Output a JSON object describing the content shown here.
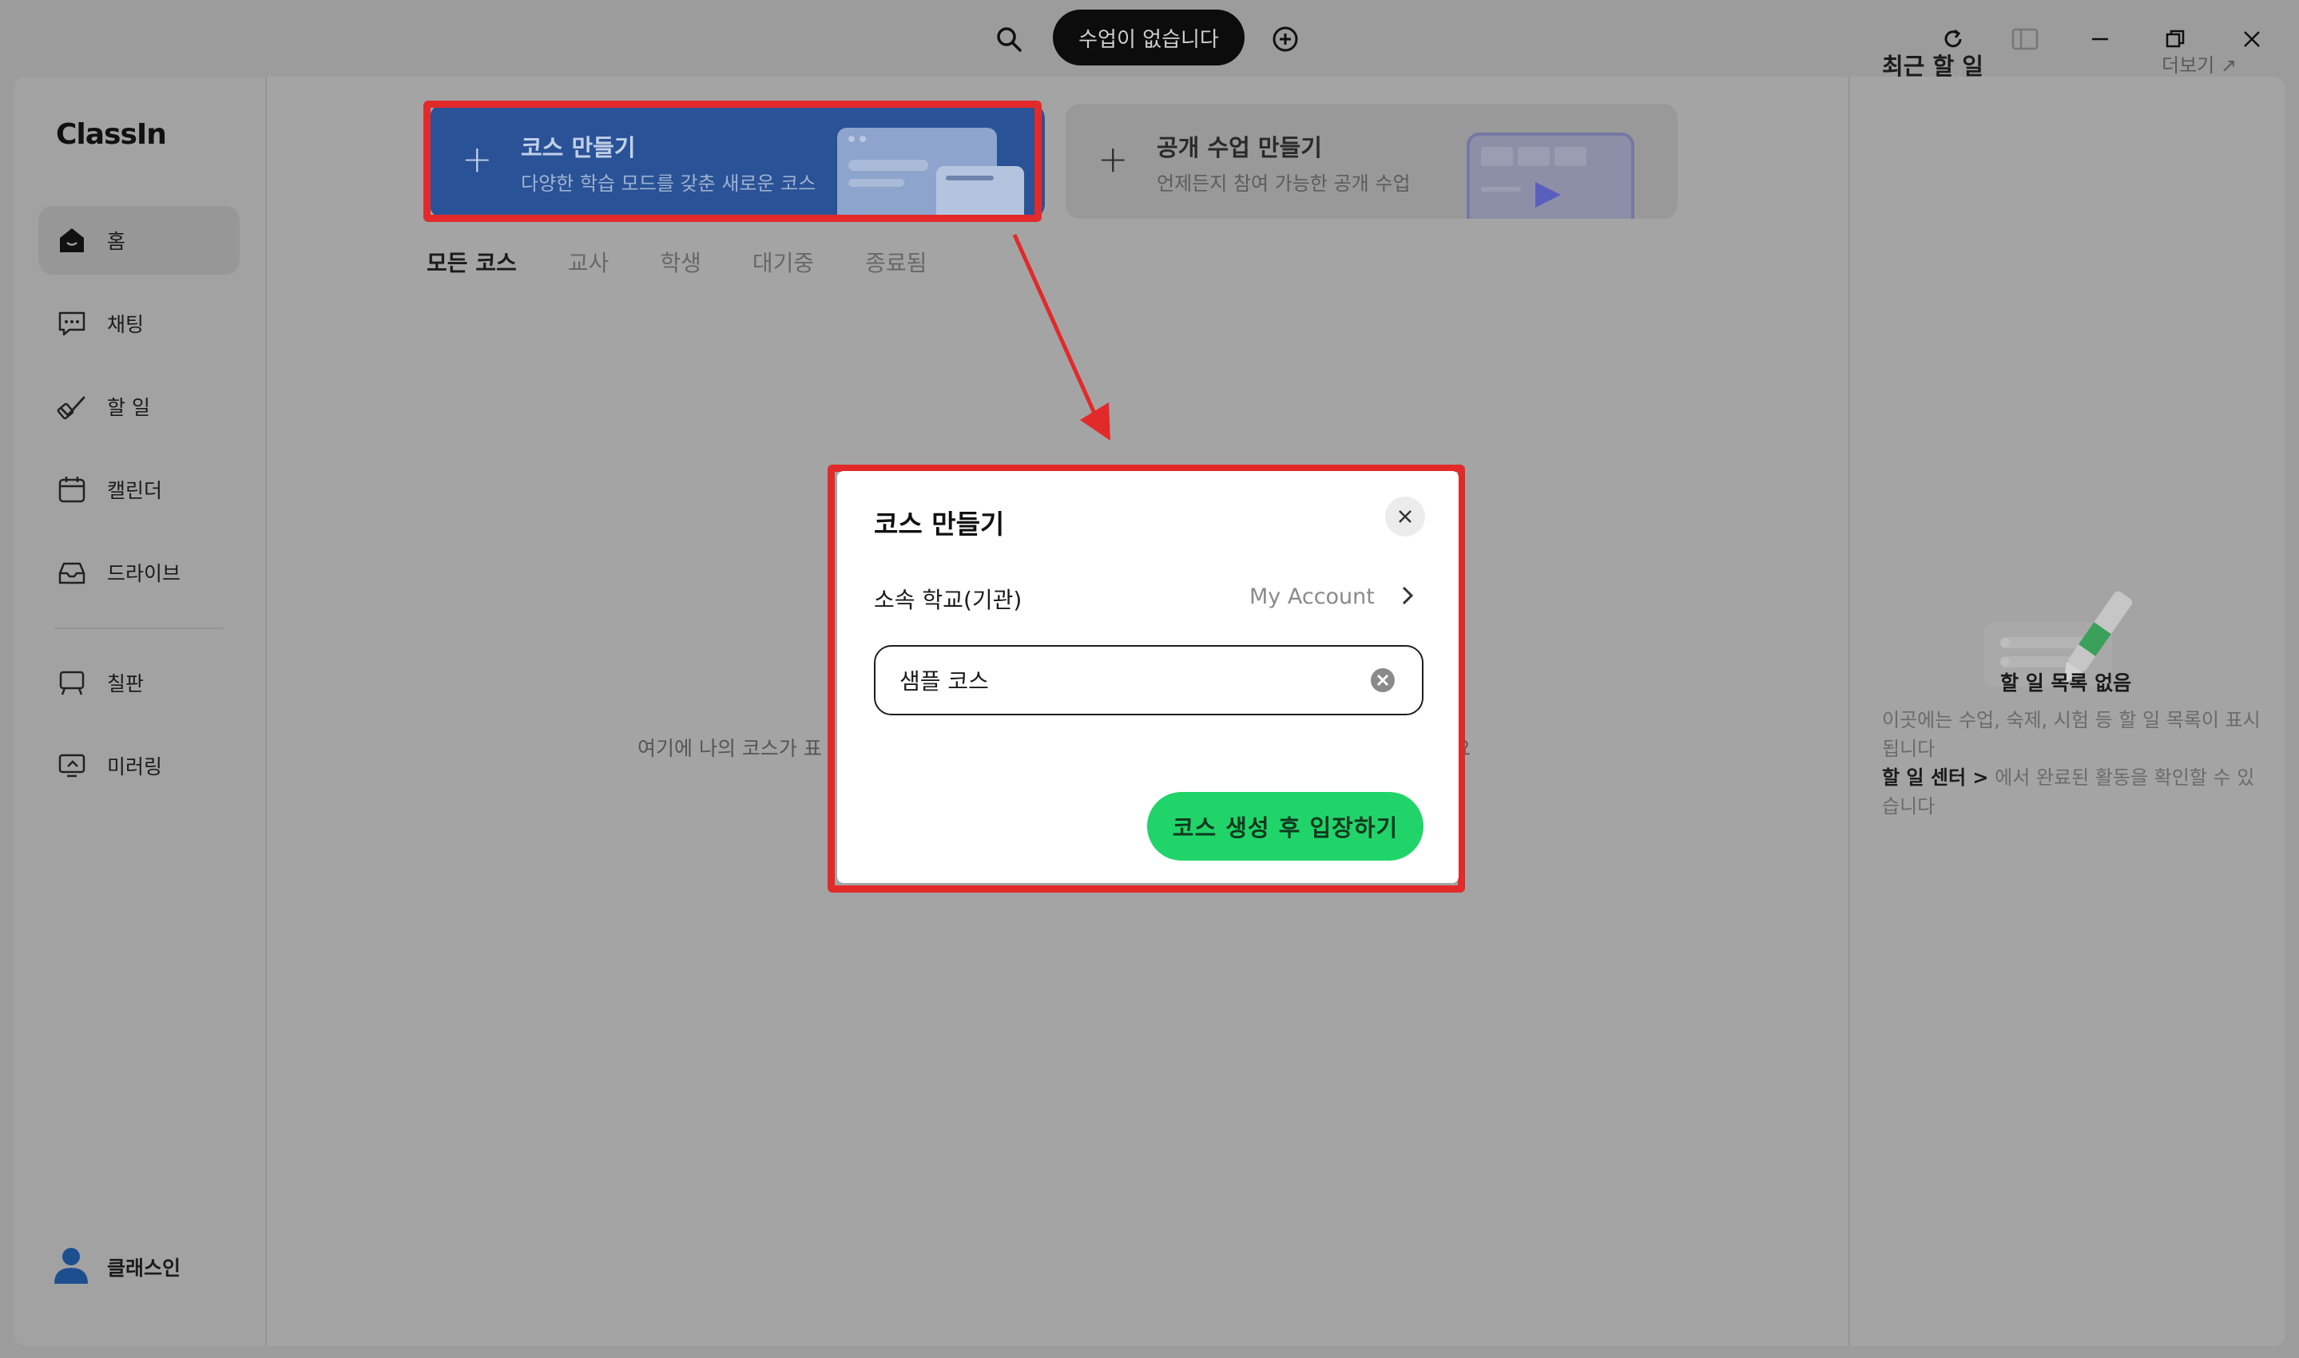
{
  "titlebar": {
    "status_label": "수업이 없습니다"
  },
  "sidebar": {
    "logo": "ClassIn",
    "items": [
      {
        "label": "홈",
        "icon": "home-icon"
      },
      {
        "label": "채팅",
        "icon": "chat-icon"
      },
      {
        "label": "할 일",
        "icon": "todo-icon"
      },
      {
        "label": "캘린더",
        "icon": "calendar-icon"
      },
      {
        "label": "드라이브",
        "icon": "drive-icon"
      },
      {
        "label": "칠판",
        "icon": "blackboard-icon"
      },
      {
        "label": "미러링",
        "icon": "mirroring-icon"
      }
    ],
    "user_name": "클래스인"
  },
  "main": {
    "create_course_card": {
      "title": "코스 만들기",
      "subtitle": "다양한 학습 모드를 갖춘 새로운 코스"
    },
    "create_public_card": {
      "title": "공개 수업 만들기",
      "subtitle": "언제든지 참여 가능한 공개 수업"
    },
    "tabs": [
      "모든 코스",
      "교사",
      "학생",
      "대기중",
      "종료됨"
    ],
    "empty_text_left": "여기에 나의 코스가 표",
    "empty_text_right": "요"
  },
  "right_panel": {
    "title": "최근 할 일",
    "more_label": "더보기 ↗",
    "empty_title": "할 일 목록 없음",
    "empty_desc_1": "이곳에는 수업, 숙제, 시험 등 할 일 목록이 표시됩니다",
    "todo_center_link": "할 일 센터 >",
    "empty_desc_2": " 에서 완료된 활동을 확인할 수 있습니다"
  },
  "modal": {
    "title": "코스 만들기",
    "org_label": "소속 학교(기관)",
    "org_value": "My Account",
    "course_name_value": "샘플 코스",
    "submit_label": "코스 생성 후 입장하기"
  },
  "colors": {
    "accent_green": "#21d46a",
    "highlight_red": "#e22a2a",
    "card_blue": "#2a5296"
  }
}
